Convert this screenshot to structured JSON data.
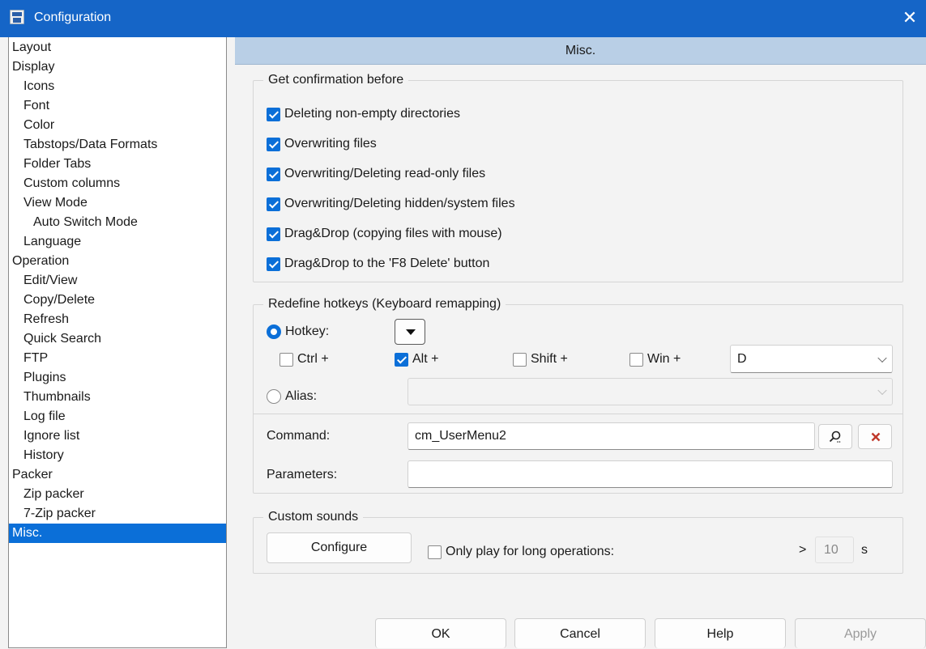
{
  "window": {
    "title": "Configuration",
    "close_glyph": "✕"
  },
  "sidebar": {
    "items": [
      {
        "label": "Layout",
        "level": 0
      },
      {
        "label": "Display",
        "level": 0
      },
      {
        "label": "Icons",
        "level": 1
      },
      {
        "label": "Font",
        "level": 1
      },
      {
        "label": "Color",
        "level": 1
      },
      {
        "label": "Tabstops/Data Formats",
        "level": 1
      },
      {
        "label": "Folder Tabs",
        "level": 1
      },
      {
        "label": "Custom columns",
        "level": 1
      },
      {
        "label": "View Mode",
        "level": 1
      },
      {
        "label": "Auto Switch Mode",
        "level": 2
      },
      {
        "label": "Language",
        "level": 1
      },
      {
        "label": "Operation",
        "level": 0
      },
      {
        "label": "Edit/View",
        "level": 1
      },
      {
        "label": "Copy/Delete",
        "level": 1
      },
      {
        "label": "Refresh",
        "level": 1
      },
      {
        "label": "Quick Search",
        "level": 1
      },
      {
        "label": "FTP",
        "level": 1
      },
      {
        "label": "Plugins",
        "level": 1
      },
      {
        "label": "Thumbnails",
        "level": 1
      },
      {
        "label": "Log file",
        "level": 1
      },
      {
        "label": "Ignore list",
        "level": 1
      },
      {
        "label": "History",
        "level": 1
      },
      {
        "label": "Packer",
        "level": 0
      },
      {
        "label": "Zip packer",
        "level": 1
      },
      {
        "label": "7-Zip packer",
        "level": 1
      },
      {
        "label": "Misc.",
        "level": 0,
        "selected": true
      }
    ]
  },
  "header": {
    "title": "Misc."
  },
  "confirm": {
    "title": "Get confirmation before",
    "options": [
      {
        "label": "Deleting non-empty directories",
        "checked": true
      },
      {
        "label": "Overwriting files",
        "checked": true
      },
      {
        "label": "Overwriting/Deleting read-only files",
        "checked": true
      },
      {
        "label": "Overwriting/Deleting hidden/system files",
        "checked": true
      },
      {
        "label": "Drag&Drop (copying files with mouse)",
        "checked": true
      },
      {
        "label": "Drag&Drop to the 'F8 Delete' button",
        "checked": true
      }
    ]
  },
  "hotkeys": {
    "title": "Redefine hotkeys (Keyboard remapping)",
    "hotkey_label": "Hotkey:",
    "hotkey_selected": true,
    "modifiers": {
      "ctrl": {
        "label": "Ctrl +",
        "checked": false
      },
      "alt": {
        "label": "Alt +",
        "checked": true
      },
      "shift": {
        "label": "Shift +",
        "checked": false
      },
      "win": {
        "label": "Win +",
        "checked": false
      }
    },
    "key_value": "D",
    "alias_label": "Alias:",
    "alias_value": "",
    "command_label": "Command:",
    "command_value": "cm_UserMenu2",
    "parameters_label": "Parameters:",
    "parameters_value": ""
  },
  "sounds": {
    "title": "Custom sounds",
    "configure_label": "Configure",
    "long_ops_label": "Only play for long operations:",
    "long_ops_checked": false,
    "gt": ">",
    "seconds_value": "10",
    "seconds_unit": "s"
  },
  "footer": {
    "ok": "OK",
    "cancel": "Cancel",
    "help": "Help",
    "apply": "Apply"
  },
  "colors": {
    "titlebar": "#1565c7",
    "selection": "#0b6fd8",
    "header": "#b9cfe6",
    "delete": "#c0392b"
  }
}
